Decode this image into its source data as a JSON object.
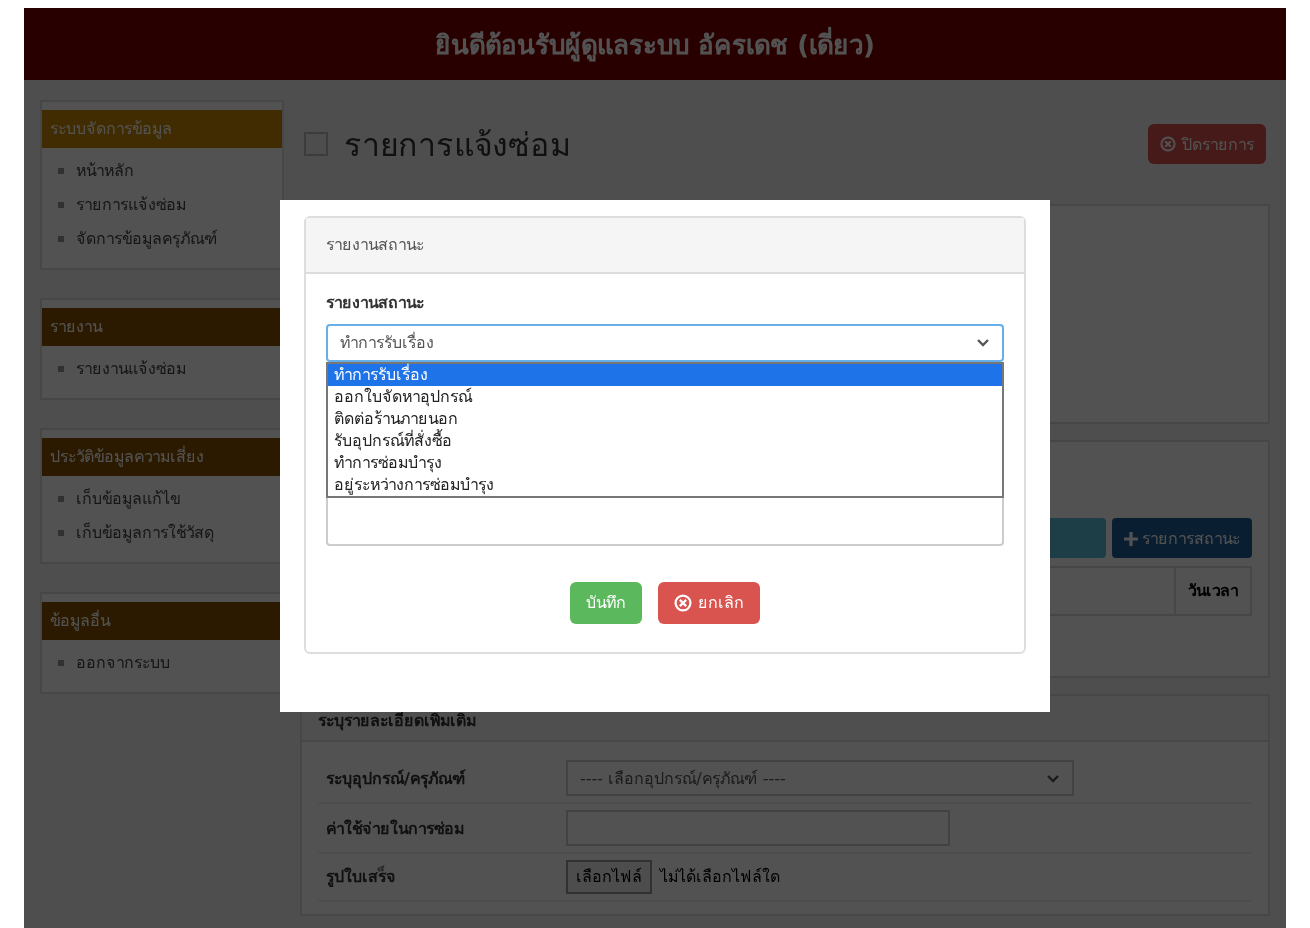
{
  "header": {
    "title": "ยินดีต้อนรับผู้ดูแลระบบ อัครเดช (เดี่ยว)"
  },
  "sidebar": {
    "groups": [
      {
        "title": "ระบบจัดการข้อมูล",
        "selected": true,
        "items": [
          "หน้าหลัก",
          "รายการแจ้งซ่อม",
          "จัดการข้อมูลครุภัณฑ์"
        ]
      },
      {
        "title": "รายงาน",
        "selected": false,
        "items": [
          "รายงานแจ้งซ่อม"
        ]
      },
      {
        "title": "ประวัติข้อมูลความเสี่ยง",
        "selected": false,
        "items": [
          "เก็บข้อมูลแก้ไข",
          "เก็บข้อมูลการใช้วัสดุ"
        ]
      },
      {
        "title": "ข้อมูลอื่น",
        "selected": false,
        "items": [
          "ออกจากระบบ"
        ]
      }
    ]
  },
  "page": {
    "title": "รายการแจ้งซ่อม",
    "close_button": "ปิดรายการ"
  },
  "status_section": {
    "add_button": "รายการสถานะ",
    "column": "วันเวลา"
  },
  "details": {
    "title": "ระบุรายละเอียดเพิ่มเติม",
    "rows": [
      {
        "kind": "select",
        "label": "ระบุอุปกรณ์/ครุภัณฑ์",
        "placeholder": "---- เลือกอุปกรณ์/ครุภัณฑ์ ----"
      },
      {
        "kind": "input",
        "label": "ค่าใช้จ่ายในการซ่อม"
      },
      {
        "kind": "file",
        "label": "รูปใบเสร็จ",
        "button": "เลือกไฟล์",
        "value": "ไม่ได้เลือกไฟล์ใด"
      }
    ]
  },
  "modal": {
    "header": "รายงานสถานะ",
    "label": "รายงานสถานะ",
    "value": "ทำการรับเรื่อง",
    "options": [
      {
        "label": "ทำการรับเรื่อง",
        "selected": true
      },
      {
        "label": "ออกใบจัดหาอุปกรณ์",
        "selected": false
      },
      {
        "label": "ติดต่อร้านภายนอก",
        "selected": false
      },
      {
        "label": "รับอุปกรณ์ที่สั่งซื้อ",
        "selected": false
      },
      {
        "label": "ทำการซ่อมบำรุง",
        "selected": false
      },
      {
        "label": "อยู่ระหว่างการซ่อมบำรุง",
        "selected": false
      }
    ],
    "save_button": "บันทึก",
    "cancel_button": "ยกเลิก"
  }
}
